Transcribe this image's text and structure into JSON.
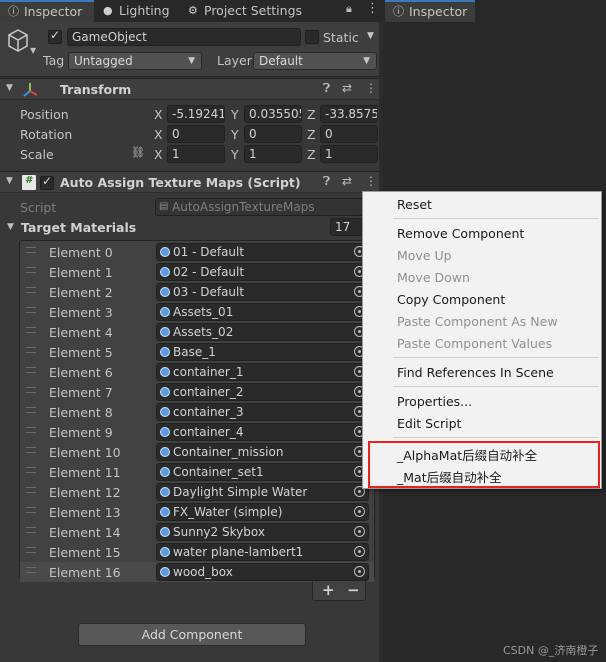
{
  "tabs": [
    {
      "label": "Inspector",
      "icon": "info-icon"
    },
    {
      "label": "Lighting",
      "icon": "bulb-icon"
    },
    {
      "label": "Project Settings",
      "icon": "gear-icon"
    }
  ],
  "right_tab": {
    "label": "Inspector",
    "icon": "info-icon"
  },
  "gameobject": {
    "name": "GameObject",
    "active": true,
    "static_label": "Static",
    "tag_label": "Tag",
    "tag_value": "Untagged",
    "layer_label": "Layer",
    "layer_value": "Default"
  },
  "transform": {
    "title": "Transform",
    "position_label": "Position",
    "rotation_label": "Rotation",
    "scale_label": "Scale",
    "axis_x": "X",
    "axis_y": "Y",
    "axis_z": "Z",
    "position": [
      "-5.19241",
      "0.035505",
      "-33.8575"
    ],
    "rotation": [
      "0",
      "0",
      "0"
    ],
    "scale": [
      "1",
      "1",
      "1"
    ]
  },
  "script_component": {
    "title": "Auto Assign Texture Maps (Script)",
    "script_label": "Script",
    "script_value": "AutoAssignTextureMaps",
    "list_label": "Target Materials",
    "list_count": "17",
    "elements": [
      {
        "label": "Element 0",
        "value": "01 - Default"
      },
      {
        "label": "Element 1",
        "value": "02 - Default"
      },
      {
        "label": "Element 2",
        "value": "03 - Default"
      },
      {
        "label": "Element 3",
        "value": "Assets_01"
      },
      {
        "label": "Element 4",
        "value": "Assets_02"
      },
      {
        "label": "Element 5",
        "value": "Base_1"
      },
      {
        "label": "Element 6",
        "value": "container_1"
      },
      {
        "label": "Element 7",
        "value": "container_2"
      },
      {
        "label": "Element 8",
        "value": "container_3"
      },
      {
        "label": "Element 9",
        "value": "container_4"
      },
      {
        "label": "Element 10",
        "value": "Container_mission"
      },
      {
        "label": "Element 11",
        "value": "Container_set1"
      },
      {
        "label": "Element 12",
        "value": "Daylight Simple Water"
      },
      {
        "label": "Element 13",
        "value": "FX_Water (simple)"
      },
      {
        "label": "Element 14",
        "value": "Sunny2 Skybox"
      },
      {
        "label": "Element 15",
        "value": "water plane-lambert1"
      },
      {
        "label": "Element 16",
        "value": "wood_box"
      }
    ],
    "add_symbol": "+",
    "remove_symbol": "−"
  },
  "add_component_label": "Add Component",
  "context_menu": {
    "reset": "Reset",
    "remove_component": "Remove Component",
    "move_up": "Move Up",
    "move_down": "Move Down",
    "copy_component": "Copy Component",
    "paste_as_new": "Paste Component As New",
    "paste_values": "Paste Component Values",
    "find_references": "Find References In Scene",
    "properties": "Properties...",
    "edit_script": "Edit Script",
    "custom_1": "_AlphaMat后缀自动补全",
    "custom_2": "_Mat后缀自动补全",
    "highlight_color": "#e8231e"
  },
  "watermark": "CSDN @_济南橙子",
  "colors": {
    "accent": "#3a79bb",
    "panel": "#383838",
    "object_dot": "#5d9be0"
  }
}
